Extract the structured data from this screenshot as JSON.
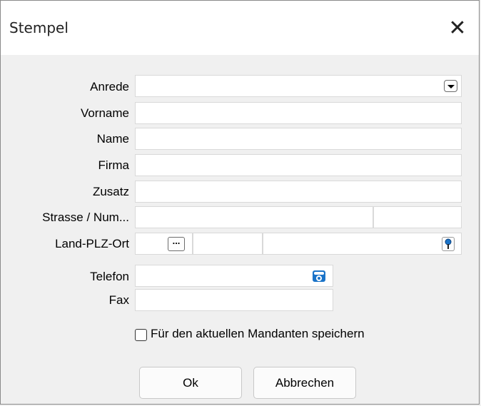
{
  "window": {
    "title": "Stempel",
    "close_symbol": "✕"
  },
  "form": {
    "anrede_label": "Anrede",
    "vorname_label": "Vorname",
    "name_label": "Name",
    "firma_label": "Firma",
    "zusatz_label": "Zusatz",
    "strasse_label": "Strasse / Num...",
    "land_label": "Land-PLZ-Ort",
    "land_lookup_text": "...",
    "telefon_label": "Telefon",
    "fax_label": "Fax"
  },
  "checkbox": {
    "label": "Für den aktuellen Mandanten speichern",
    "checked": false
  },
  "buttons": {
    "ok": "Ok",
    "cancel": "Abbrechen"
  },
  "icons": {
    "dropdown": "chevron-down-icon",
    "lookup": "ellipsis-icon",
    "map": "map-pin-icon",
    "phone": "phone-icon"
  },
  "colors": {
    "icon_blue": "#1a73c8",
    "field_bg": "#ffffff",
    "dialog_bg": "#f0f0f0"
  }
}
